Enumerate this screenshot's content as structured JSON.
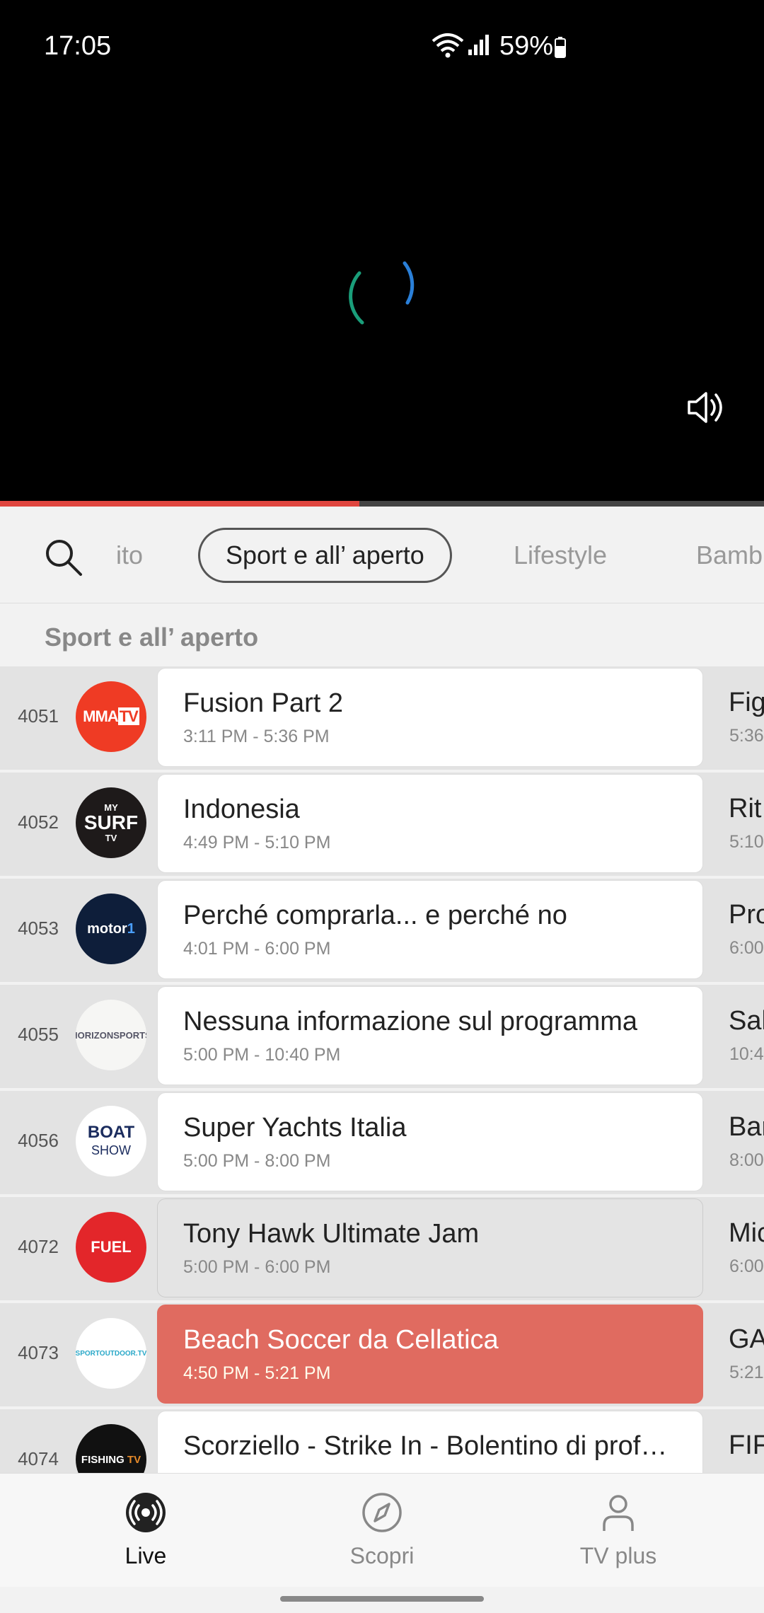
{
  "status": {
    "time": "17:05",
    "battery": "59%"
  },
  "player": {
    "progress_fraction": 0.47
  },
  "categories": [
    {
      "label": "ito",
      "active": false
    },
    {
      "label": "Sport e all’ aperto",
      "active": true
    },
    {
      "label": "Lifestyle",
      "active": false
    },
    {
      "label": "Bamb",
      "active": false
    }
  ],
  "section_title": "Sport e all’ aperto",
  "channels": [
    {
      "number": "4051",
      "logo": "MMATV",
      "title": "Fusion Part 2",
      "time": "3:11 PM - 5:36 PM",
      "next_title": "Fig",
      "next_time": "5:36",
      "state": "normal"
    },
    {
      "number": "4052",
      "logo": "MY SURF TV",
      "title": "Indonesia",
      "time": "4:49 PM - 5:10 PM",
      "next_title": "Rit",
      "next_time": "5:10",
      "state": "normal"
    },
    {
      "number": "4053",
      "logo": "motor1 TV",
      "title": "Perché comprarla... e perché no",
      "time": "4:01 PM - 6:00 PM",
      "next_title": "Pro",
      "next_time": "6:00",
      "state": "normal"
    },
    {
      "number": "4055",
      "logo": "HORIZON SPORTS",
      "title": "Nessuna informazione sul programma",
      "time": "5:00 PM - 10:40 PM",
      "next_title": "Sal",
      "next_time": "10:4",
      "state": "normal"
    },
    {
      "number": "4056",
      "logo": "THE BOAT SHOW",
      "title": "Super Yachts Italia",
      "time": "5:00 PM - 8:00 PM",
      "next_title": "Bar",
      "next_time": "8:00",
      "state": "normal"
    },
    {
      "number": "4072",
      "logo": "FUEL TV",
      "title": "Tony Hawk Ultimate Jam",
      "time": "5:00 PM - 6:00 PM",
      "next_title": "Mic",
      "next_time": "6:00",
      "state": "selected"
    },
    {
      "number": "4073",
      "logo": "SPORTOUTDOOR.TV",
      "title": "Beach Soccer da Cellatica",
      "time": "4:50 PM - 5:21 PM",
      "next_title": "GA",
      "next_time": "5:21",
      "state": "live"
    },
    {
      "number": "4074",
      "logo": "FISHING TV",
      "title": "Scorziello - Strike In - Bolentino di prof…",
      "time": "",
      "next_title": "FIF",
      "next_time": "",
      "state": "normal"
    }
  ],
  "nav": [
    {
      "label": "Live",
      "icon": "live-broadcast-icon",
      "active": true
    },
    {
      "label": "Scopri",
      "icon": "compass-icon",
      "active": false
    },
    {
      "label": "TV plus",
      "icon": "person-icon",
      "active": false
    }
  ],
  "colors": {
    "accent": "#e0463f",
    "live_card": "#e06b60",
    "spinner_green": "#1a9e7a",
    "spinner_blue": "#2a7fd8"
  }
}
